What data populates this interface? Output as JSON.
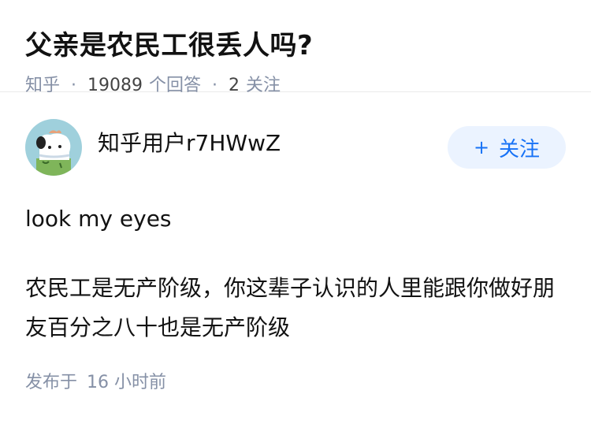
{
  "question": {
    "title": "父亲是农民工很丢人吗?",
    "source": "知乎",
    "answer_count": "19089",
    "answer_label": "个回答",
    "follower_count": "2",
    "follower_label": "关注",
    "separator": "·"
  },
  "answer": {
    "author_name": "知乎用户r7HWwZ",
    "follow_button": {
      "icon": "+",
      "label": "关注"
    },
    "paragraphs": [
      "look my eyes",
      "农民工是无产阶级，你这辈子认识的人里能跟你做好朋友百分之八十也是无产阶级"
    ],
    "published_label": "发布于",
    "published_time": "16 小时前"
  },
  "colors": {
    "meta_gray": "#8590a6",
    "accent_blue": "#1772f6",
    "button_bg": "#ebf3ff"
  }
}
